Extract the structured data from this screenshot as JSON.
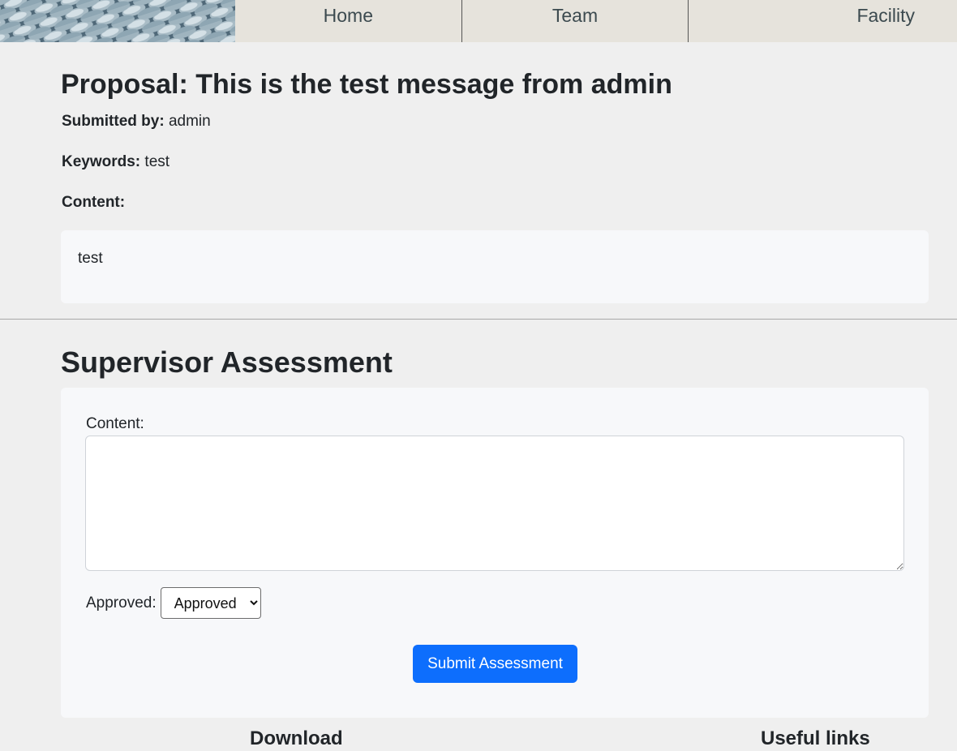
{
  "nav": {
    "items": [
      {
        "label": "Home"
      },
      {
        "label": "Team"
      },
      {
        "label": "Facility"
      }
    ]
  },
  "proposal": {
    "title": "Proposal: This is the test message from admin",
    "submitted_by_label": "Submitted by:",
    "submitted_by_value": "admin",
    "keywords_label": "Keywords:",
    "keywords_value": "test",
    "content_label": "Content:",
    "content_value": "test"
  },
  "assessment": {
    "title": "Supervisor Assessment",
    "content_label": "Content:",
    "content_value": "",
    "approved_label": "Approved:",
    "approved_selected": "Approved",
    "submit_label": "Submit Assessment"
  },
  "footer": {
    "download_heading": "Download",
    "links_heading": "Useful links"
  },
  "colors": {
    "primary": "#0d6efd",
    "page_bg": "#efefef",
    "nav_bg": "#e6e3dc",
    "card_bg": "#f7f8fa"
  }
}
